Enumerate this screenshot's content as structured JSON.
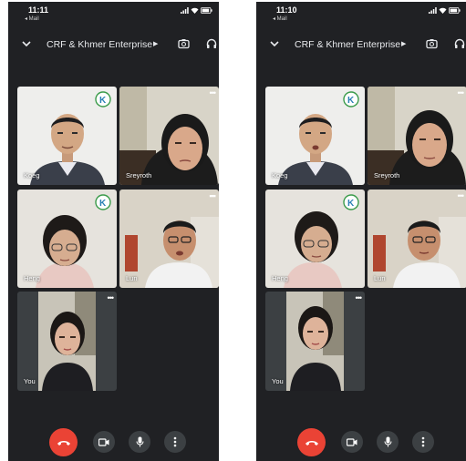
{
  "phones": [
    {
      "status": {
        "time": "11:11",
        "back_label": "◂ Mail"
      },
      "header": {
        "title": "CRF & Khmer Enterprise"
      },
      "tiles": [
        {
          "name": "Koeg"
        },
        {
          "name": "Sreyroth"
        },
        {
          "name": "Heng"
        },
        {
          "name": "Lun"
        }
      ],
      "self_tile": {
        "name": "You"
      }
    },
    {
      "status": {
        "time": "11:10",
        "back_label": "◂ Mail"
      },
      "header": {
        "title": "CRF & Khmer Enterprise"
      },
      "tiles": [
        {
          "name": "Koeg"
        },
        {
          "name": "Sreyroth"
        },
        {
          "name": "Heng"
        },
        {
          "name": "Lun"
        }
      ],
      "self_tile": {
        "name": "You"
      }
    }
  ],
  "colors": {
    "background": "#202124",
    "tile_self": "#3c4043",
    "end_call": "#ea4335",
    "control_button": "#3c4043"
  },
  "icons": {
    "header": [
      "chevron-down-icon",
      "camera-switch-icon",
      "headphones-icon"
    ],
    "controls": [
      "end-call-icon",
      "camera-icon",
      "microphone-icon",
      "more-vert-icon"
    ]
  }
}
